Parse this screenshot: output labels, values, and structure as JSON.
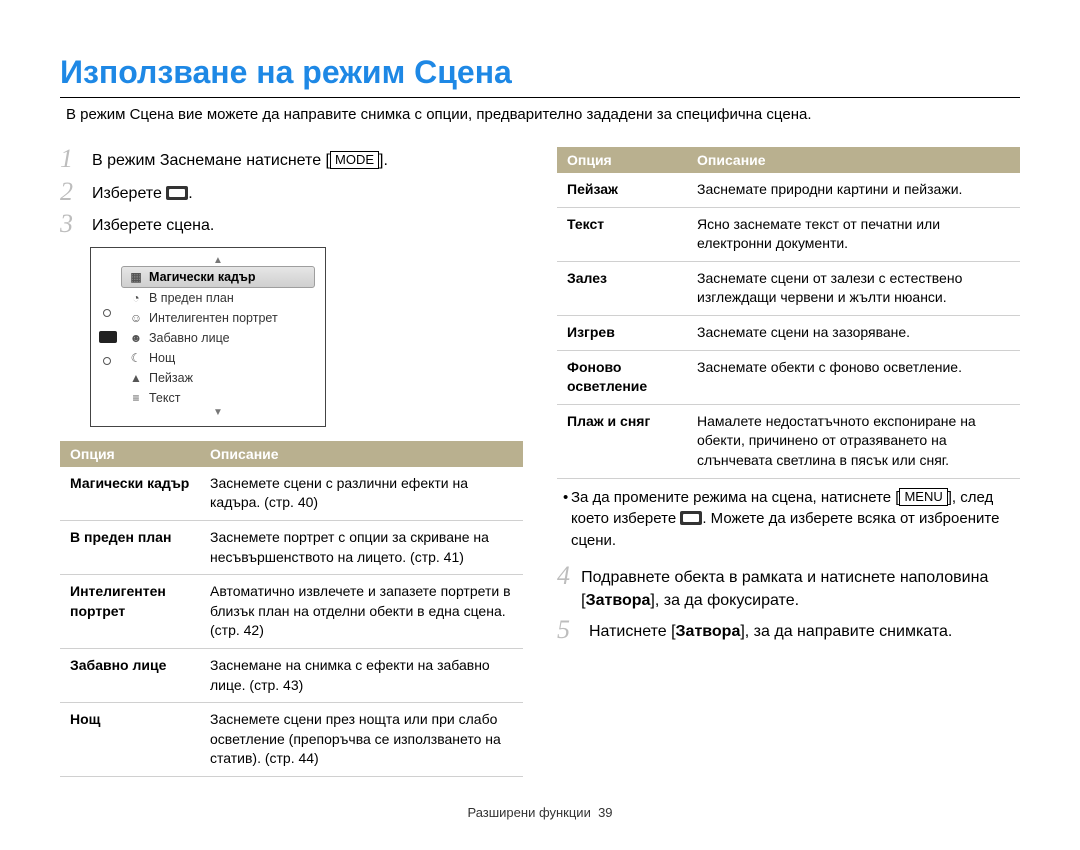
{
  "title": "Използване на режим Сцена",
  "intro": "В режим Сцена вие можете да направите снимка с опции, предварително зададени за специфична сцена.",
  "steps_left": {
    "1": {
      "pre": "В режим Заснемане натиснете ",
      "btn": "MODE",
      "post": "."
    },
    "2": {
      "pre": "Изберете ",
      "post": "."
    },
    "3": "Изберете сцена."
  },
  "cam_menu": {
    "items": [
      {
        "icon": "▦",
        "label": "Магически кадър",
        "selected": true
      },
      {
        "icon": "◔",
        "label": "В преден план"
      },
      {
        "icon": "☺",
        "label": "Интелигентен портрет"
      },
      {
        "icon": "☻",
        "label": "Забавно лице"
      },
      {
        "icon": "☾",
        "label": "Нощ"
      },
      {
        "icon": "▲",
        "label": "Пейзаж"
      },
      {
        "icon": "≡",
        "label": "Текст"
      }
    ]
  },
  "table_left": {
    "head": {
      "c1": "Опция",
      "c2": "Описание"
    },
    "rows": [
      {
        "c1": "Магически кадър",
        "c2": "Заснемете сцени с различни ефекти на кадъра. (стр. 40)"
      },
      {
        "c1": "В преден план",
        "c2": "Заснемете портрет с опции за скриване на несъвършенството на лицето. (стр. 41)"
      },
      {
        "c1": "Интелигентен портрет",
        "c2": "Автоматично извлечете и запазете портрети в близък план на отделни обекти в една сцена. (стр. 42)"
      },
      {
        "c1": "Забавно лице",
        "c2": "Заснемане на снимка с ефекти на забавно лице. (стр. 43)"
      },
      {
        "c1": "Нощ",
        "c2": "Заснемете сцени през нощта или при слабо осветление (препоръчва се използването на статив). (стр. 44)"
      }
    ]
  },
  "table_right": {
    "head": {
      "c1": "Опция",
      "c2": "Описание"
    },
    "rows": [
      {
        "c1": "Пейзаж",
        "c2": "Заснемате природни картини и пейзажи."
      },
      {
        "c1": "Текст",
        "c2": "Ясно заснемате текст от печатни или електронни документи."
      },
      {
        "c1": "Залез",
        "c2": "Заснемате сцени от залези с естествено изглеждащи червени и жълти нюанси."
      },
      {
        "c1": "Изгрев",
        "c2": "Заснемате сцени на зазоряване."
      },
      {
        "c1": "Фоново осветление",
        "c2": "Заснемате обекти с фоново осветление."
      },
      {
        "c1": "Плаж и сняг",
        "c2": "Намалете недостатъчното експониране на обекти, причинено от отразяването на слънчевата светлина в пясък или сняг."
      }
    ]
  },
  "bullet_right": {
    "pre": "За да промените режима на сцена, натиснете ",
    "btn": "MENU",
    "mid": ", след което изберете ",
    "post": ". Можете да изберете всяка от изброените сцени."
  },
  "steps_right": {
    "4": {
      "pre": "Подравнете обекта в рамката и натиснете наполовина [",
      "bold": "Затвора",
      "post": "], за да фокусирате."
    },
    "5": {
      "pre": "Натиснете [",
      "bold": "Затвора",
      "post": "], за да направите снимката."
    }
  },
  "footer": {
    "label": "Разширени функции",
    "page": "39"
  }
}
